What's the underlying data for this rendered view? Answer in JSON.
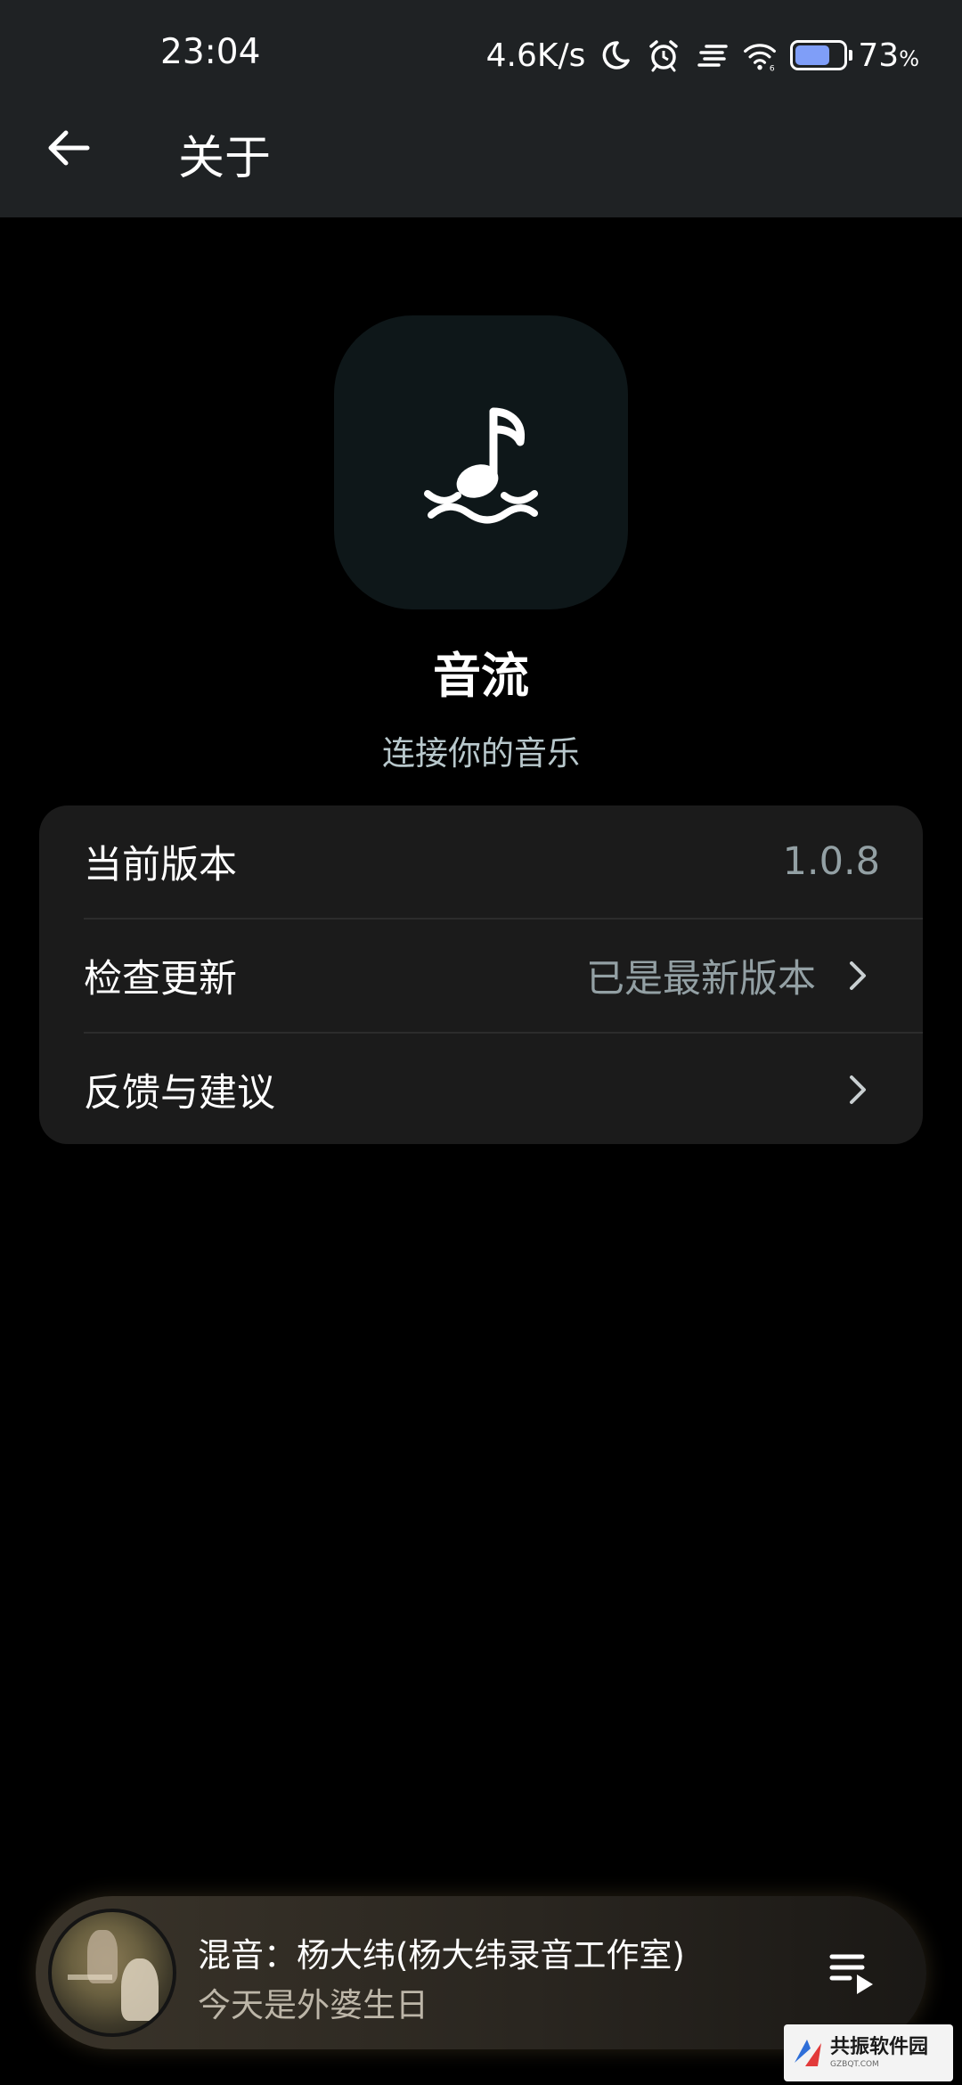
{
  "status_bar": {
    "time": "23:04",
    "network_speed": "4.6K/s",
    "battery_percent": "73",
    "battery_unit": "%",
    "battery_level": 0.73,
    "icons": [
      "moon-icon",
      "alarm-icon",
      "signal-icon",
      "wifi-icon",
      "battery-icon"
    ]
  },
  "app_bar": {
    "title": "关于",
    "back_icon": "arrow-left-icon"
  },
  "app_info": {
    "name": "音流",
    "slogan": "连接你的音乐",
    "logo_icon": "music-note-waves-icon"
  },
  "settings": {
    "items": [
      {
        "label": "当前版本",
        "value": "1.0.8",
        "has_chevron": false
      },
      {
        "label": "检查更新",
        "value": "已是最新版本",
        "has_chevron": true
      },
      {
        "label": "反馈与建议",
        "value": "",
        "has_chevron": true
      }
    ]
  },
  "mini_player": {
    "title": "混音：杨大纬(杨大纬录音工作室)",
    "subtitle": "今天是外婆生日",
    "queue_icon": "playlist-play-icon"
  },
  "watermark": {
    "main": "共振软件园",
    "sub": "GZBQT.COM"
  },
  "colors": {
    "header_bg": "#1f2224",
    "background": "#000000",
    "card_bg": "#1b1b1b",
    "logo_bg": "#0e1719",
    "slogan": "#b8c8cc",
    "secondary_text": "#93a0a4",
    "battery_fill": "#7f9ef8"
  }
}
